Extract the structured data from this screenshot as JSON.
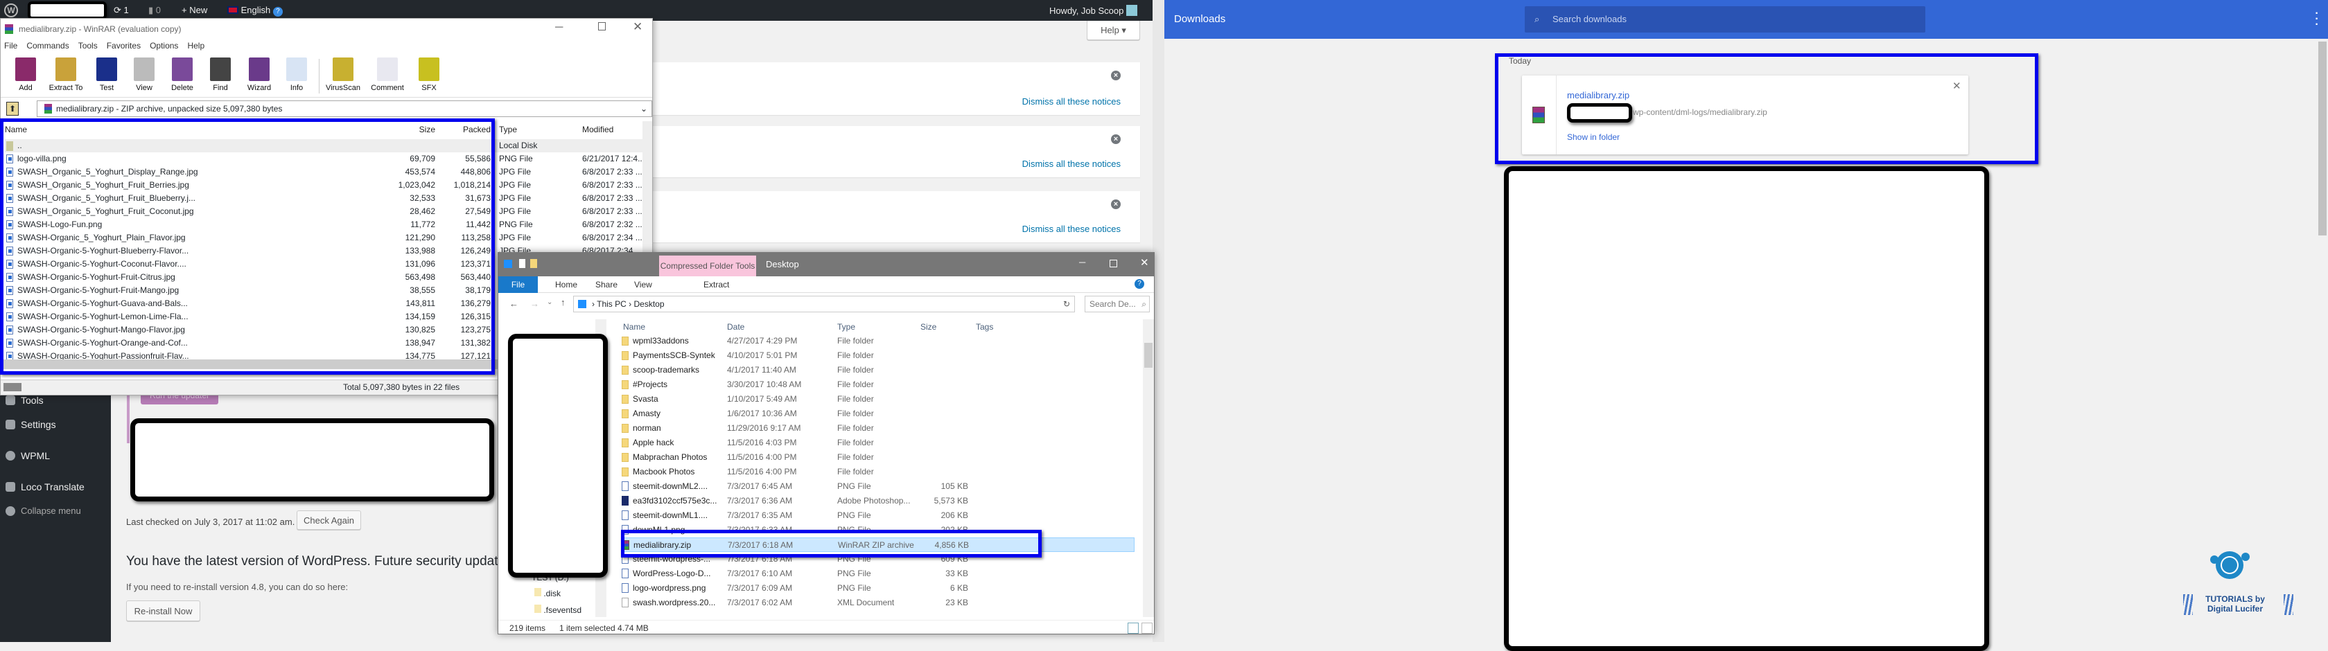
{
  "wp_admin_bar": {
    "updates_count": "1",
    "comments_count": "0",
    "new_label": "New",
    "language": "English",
    "greeting": "Howdy, Job Scoop"
  },
  "wp_sidebar": {
    "items": [
      {
        "label": "Tools",
        "icon": "wrench-icon"
      },
      {
        "label": "Settings",
        "icon": "settings-icon"
      },
      {
        "label": "WPML",
        "icon": "wpml-icon"
      },
      {
        "label": "Loco Translate",
        "icon": "translate-icon"
      },
      {
        "label": "Collapse menu",
        "icon": "collapse-icon"
      }
    ]
  },
  "wp_content": {
    "help_label": "Help ▾",
    "notices": [
      {
        "dismiss_label": "Dismiss all these notices"
      },
      {
        "dismiss_label": "Dismiss all these notices"
      },
      {
        "dismiss_label": "Dismiss all these notices"
      }
    ],
    "run_updater_label": "Run the updater",
    "last_checked": "Last checked on July 3, 2017 at 11:02 am.",
    "check_again_label": "Check Again",
    "latest_heading": "You have the latest version of WordPress. Future security updates will b",
    "reinstall_text": "If you need to re-install version 4.8, you can do so here:",
    "reinstall_label": "Re-install Now"
  },
  "winrar": {
    "title": "medialibrary.zip - WinRAR (evaluation copy)",
    "menu": [
      "File",
      "Commands",
      "Tools",
      "Favorites",
      "Options",
      "Help"
    ],
    "toolbar": [
      "Add",
      "Extract To",
      "Test",
      "View",
      "Delete",
      "Find",
      "Wizard",
      "Info",
      "VirusScan",
      "Comment",
      "SFX"
    ],
    "toolbar_colors": [
      "#8a2a6a",
      "#c9a23a",
      "#1a2f8a",
      "#bbbbbb",
      "#7a4a9a",
      "#444444",
      "#6a3a8a",
      "#d8e4f4",
      "#c8b030",
      "#e8e8f0",
      "#c8c020"
    ],
    "address": "medialibrary.zip - ZIP archive, unpacked size 5,097,380 bytes",
    "columns": {
      "name": "Name",
      "size": "Size",
      "packed": "Packed",
      "type": "Type",
      "modified": "Modified"
    },
    "parent_row": {
      "name": "..",
      "type": "Local Disk"
    },
    "files": [
      {
        "name": "logo-villa.png",
        "size": "69,709",
        "packed": "55,586",
        "type": "PNG File",
        "modified": "6/21/2017 12:4..."
      },
      {
        "name": "SWASH_Organic_5_Yoghurt_Display_Range.jpg",
        "size": "453,574",
        "packed": "448,806",
        "type": "JPG File",
        "modified": "6/8/2017 2:33 ..."
      },
      {
        "name": "SWASH_Organic_5_Yoghurt_Fruit_Berries.jpg",
        "size": "1,023,042",
        "packed": "1,018,214",
        "type": "JPG File",
        "modified": "6/8/2017 2:33 ..."
      },
      {
        "name": "SWASH_Organic_5_Yoghurt_Fruit_Blueberry.j...",
        "size": "32,533",
        "packed": "31,673",
        "type": "JPG File",
        "modified": "6/8/2017 2:33 ..."
      },
      {
        "name": "SWASH_Organic_5_Yoghurt_Fruit_Coconut.jpg",
        "size": "28,462",
        "packed": "27,549",
        "type": "JPG File",
        "modified": "6/8/2017 2:33 ..."
      },
      {
        "name": "SWASH-Logo-Fun.png",
        "size": "11,772",
        "packed": "11,442",
        "type": "PNG File",
        "modified": "6/8/2017 2:32 ..."
      },
      {
        "name": "SWASH-Organic_5_Yoghurt_Plain_Flavor.jpg",
        "size": "121,290",
        "packed": "113,258",
        "type": "JPG File",
        "modified": "6/8/2017 2:34 ..."
      },
      {
        "name": "SWASH-Organic-5-Yoghurt-Blueberry-Flavor...",
        "size": "133,988",
        "packed": "126,249",
        "type": "JPG File",
        "modified": "6/8/2017 2:34 ..."
      },
      {
        "name": "SWASH-Organic-5-Yoghurt-Coconut-Flavor....",
        "size": "131,096",
        "packed": "123,371"
      },
      {
        "name": "SWASH-Organic-5-Yoghurt-Fruit-Citrus.jpg",
        "size": "563,498",
        "packed": "563,440"
      },
      {
        "name": "SWASH-Organic-5-Yoghurt-Fruit-Mango.jpg",
        "size": "38,555",
        "packed": "38,179"
      },
      {
        "name": "SWASH-Organic-5-Yoghurt-Guava-and-Bals...",
        "size": "143,811",
        "packed": "136,279"
      },
      {
        "name": "SWASH-Organic-5-Yoghurt-Lemon-Lime-Fla...",
        "size": "134,159",
        "packed": "126,315"
      },
      {
        "name": "SWASH-Organic-5-Yoghurt-Mango-Flavor.jpg",
        "size": "130,825",
        "packed": "123,275"
      },
      {
        "name": "SWASH-Organic-5-Yoghurt-Orange-and-Cof...",
        "size": "138,947",
        "packed": "131,382"
      },
      {
        "name": "SWASH-Organic-5-Yoghurt-Passionfruit-Flav...",
        "size": "134,775",
        "packed": "127,121"
      }
    ],
    "status": "Total 5,097,380 bytes in 22 files"
  },
  "explorer": {
    "context_tab": "Compressed Folder Tools",
    "title": "Desktop",
    "ribbon_tabs": [
      "File",
      "Home",
      "Share",
      "View",
      "Extract"
    ],
    "breadcrumb": [
      "This PC",
      "Desktop"
    ],
    "search_placeholder": "Search De...",
    "columns": {
      "name": "Name",
      "date": "Date",
      "type": "Type",
      "size": "Size",
      "tags": "Tags"
    },
    "files": [
      {
        "name": "wpml33addons",
        "date": "4/27/2017 4:29 PM",
        "type": "File folder",
        "size": "",
        "kind": "folder"
      },
      {
        "name": "PaymentsSCB-Syntek",
        "date": "4/10/2017 5:01 PM",
        "type": "File folder",
        "size": "",
        "kind": "folder"
      },
      {
        "name": "scoop-trademarks",
        "date": "4/1/2017 11:40 AM",
        "type": "File folder",
        "size": "",
        "kind": "folder"
      },
      {
        "name": "#Projects",
        "date": "3/30/2017 10:48 AM",
        "type": "File folder",
        "size": "",
        "kind": "folder"
      },
      {
        "name": "Svasta",
        "date": "1/10/2017 5:49 AM",
        "type": "File folder",
        "size": "",
        "kind": "folder"
      },
      {
        "name": "Amasty",
        "date": "1/6/2017 10:36 AM",
        "type": "File folder",
        "size": "",
        "kind": "folder"
      },
      {
        "name": "norman",
        "date": "11/29/2016 9:17 AM",
        "type": "File folder",
        "size": "",
        "kind": "folder"
      },
      {
        "name": "Apple hack",
        "date": "11/5/2016 4:03 PM",
        "type": "File folder",
        "size": "",
        "kind": "folder"
      },
      {
        "name": "Mabprachan Photos",
        "date": "11/5/2016 4:00 PM",
        "type": "File folder",
        "size": "",
        "kind": "folder"
      },
      {
        "name": "Macbook Photos",
        "date": "11/5/2016 4:00 PM",
        "type": "File folder",
        "size": "",
        "kind": "folder"
      },
      {
        "name": "steemit-downML2....",
        "date": "7/3/2017 6:45 AM",
        "type": "PNG File",
        "size": "105 KB",
        "kind": "png"
      },
      {
        "name": "ea3fd3102ccf575e3c...",
        "date": "7/3/2017 6:36 AM",
        "type": "Adobe Photoshop...",
        "size": "5,573 KB",
        "kind": "psd"
      },
      {
        "name": "steemit-downML1....",
        "date": "7/3/2017 6:35 AM",
        "type": "PNG File",
        "size": "206 KB",
        "kind": "png"
      },
      {
        "name": "downML1.png",
        "date": "7/3/2017 6:33 AM",
        "type": "PNG File",
        "size": "202 KB",
        "kind": "png"
      },
      {
        "name": "medialibrary.zip",
        "date": "7/3/2017 6:18 AM",
        "type": "WinRAR ZIP archive",
        "size": "4,856 KB",
        "kind": "zip",
        "selected": true
      },
      {
        "name": "steemit-wordpress-...",
        "date": "7/3/2017 6:18 AM",
        "type": "PNG File",
        "size": "609 KB",
        "kind": "png"
      },
      {
        "name": "WordPress-Logo-D...",
        "date": "7/3/2017 6:10 AM",
        "type": "PNG File",
        "size": "33 KB",
        "kind": "png"
      },
      {
        "name": "logo-wordpress.png",
        "date": "7/3/2017 6:09 AM",
        "type": "PNG File",
        "size": "6 KB",
        "kind": "png"
      },
      {
        "name": "swash.wordpress.20...",
        "date": "7/3/2017 6:02 AM",
        "type": "XML Document",
        "size": "23 KB",
        "kind": "xml"
      }
    ],
    "nav_items": [
      "TEST (D:)",
      ".disk",
      ".fseventsd"
    ],
    "status_items": "219 items",
    "status_selected": "1 item selected  4.74 MB"
  },
  "chrome_downloads": {
    "title": "Downloads",
    "search_placeholder": "Search downloads",
    "section": "Today",
    "item": {
      "filename": "medialibrary.zip",
      "url_suffix": "wp-content/dml-logs/medialibrary.zip",
      "show_in_folder": "Show in folder"
    },
    "header_color": "#3367d6"
  },
  "watermark": {
    "text": "TUTORIALS by Digital Lucifer"
  },
  "highlight_color": "#0000ee"
}
